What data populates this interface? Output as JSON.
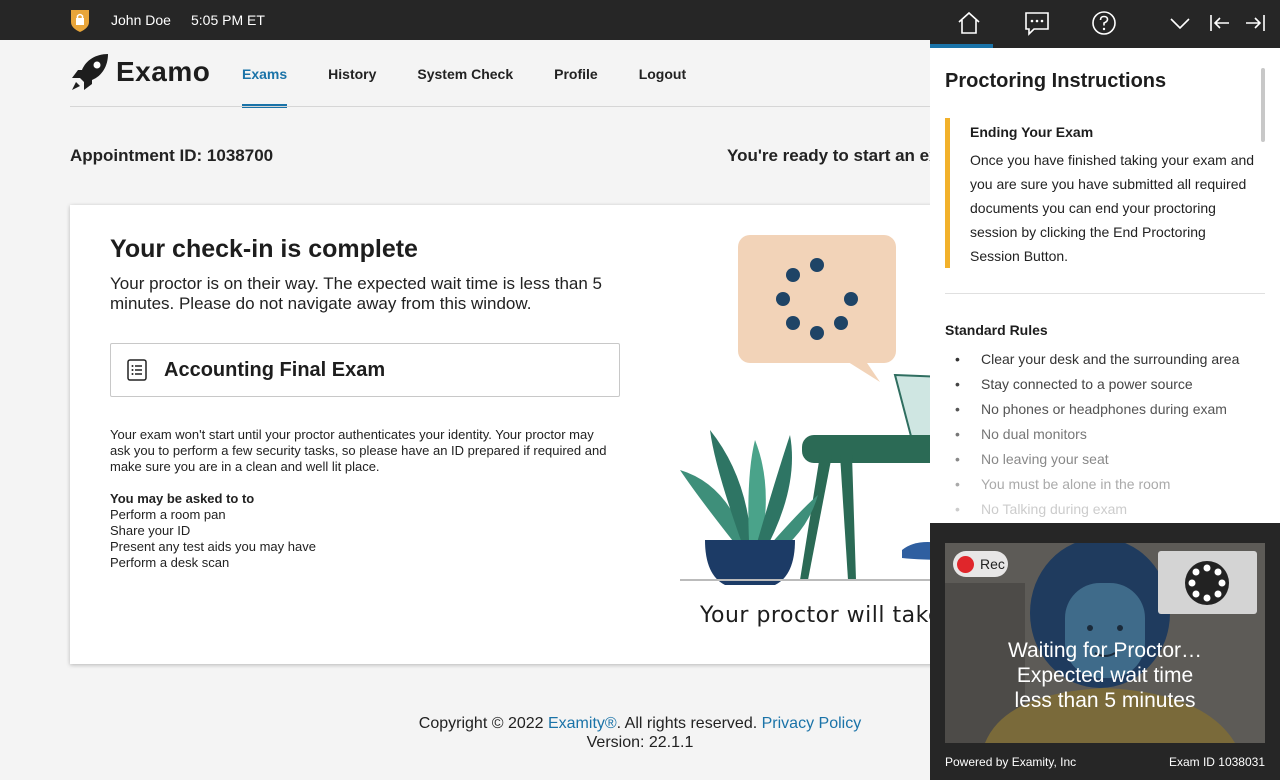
{
  "topbar": {
    "user": "John Doe",
    "time": "5:05 PM ET"
  },
  "app": {
    "logo_text": "Examo",
    "nav": [
      {
        "label": "Exams",
        "active": true
      },
      {
        "label": "History",
        "active": false
      },
      {
        "label": "System Check",
        "active": false
      },
      {
        "label": "Profile",
        "active": false
      },
      {
        "label": "Logout",
        "active": false
      }
    ],
    "appointment": "Appointment ID: 1038700",
    "ready": "You're ready to start an ex"
  },
  "card": {
    "title": "Your check-in is complete",
    "subtitle": "Your proctor is on their way. The expected wait time is less than 5 minutes. Please do not navigate away from this window.",
    "exam_name": "Accounting Final Exam",
    "info": "Your exam won't start until your proctor authenticates your identity. Your proctor may ask you to perform a few security tasks, so please have an ID prepared if required and make sure you are in a clean and well lit place.",
    "asked_title": "You may be asked to to",
    "asked_items": [
      "Perform a room pan",
      "Share your ID",
      "Present any test aids you may have",
      "Perform a desk scan"
    ],
    "take_text": "Your proctor will take"
  },
  "footer": {
    "copyright_prefix": "Copyright © 2022",
    "brand_link": "Examity®",
    "rights": ".  All rights reserved.",
    "privacy_link": "Privacy Policy",
    "version": "Version: 22.1.1"
  },
  "panel": {
    "title": "Proctoring Instructions",
    "callout_title": "Ending Your Exam",
    "callout_body": "Once you have finished taking your exam and you are sure you have submitted all required documents you can end your proctoring session by clicking the End Proctoring Session Button.",
    "rules_title": "Standard Rules",
    "rules": [
      "Clear your desk and the surrounding area",
      "Stay connected to a power source",
      "No phones or headphones during exam",
      "No dual monitors",
      "No leaving your seat",
      "You must be alone in the room",
      "No Talking during exam"
    ],
    "video": {
      "rec_label": "Rec",
      "wait_line1": "Waiting for Proctor…",
      "wait_line2": "Expected wait time",
      "wait_line3": "less than 5 minutes"
    },
    "powered_by": "Powered by Examity, Inc",
    "exam_id": "Exam ID 1038031"
  },
  "colors": {
    "accent": "#1a73a8",
    "callout": "#f2b12b",
    "topbar": "#262626",
    "rec": "#e0262b"
  }
}
